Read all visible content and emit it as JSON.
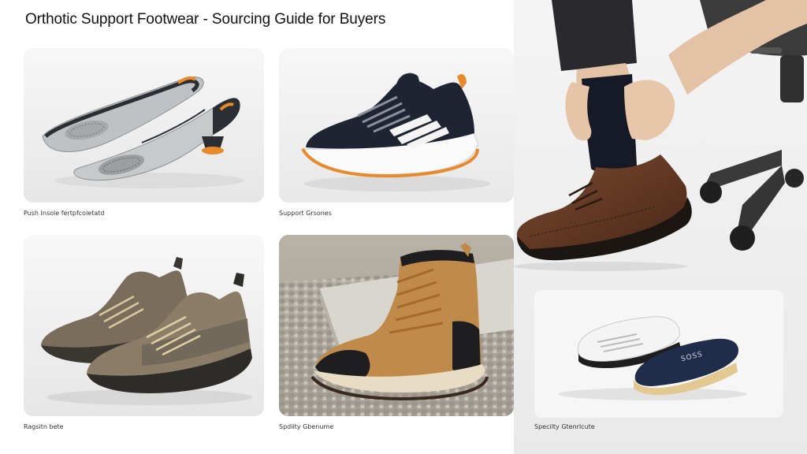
{
  "page": {
    "title": "Orthotic Support Footwear - Sourcing Guide for Buyers"
  },
  "cards": [
    {
      "id": "insoles",
      "caption": "Push Insole fertpfcoletatd",
      "subject": "insoles-icon"
    },
    {
      "id": "sneaker",
      "caption": "Support Grsones",
      "subject": "sneaker-icon"
    },
    {
      "id": "hiking",
      "caption": "Ragsitn bete",
      "subject": "hiking-shoe-icon"
    },
    {
      "id": "boot",
      "caption": "Spdiity Gbenume",
      "subject": "work-boot-icon"
    }
  ],
  "feature": {
    "subject": "person-wearing-dress-shoe",
    "inset_caption": "Specilty Gtenrlcute",
    "insole_badge": "SOSS"
  }
}
